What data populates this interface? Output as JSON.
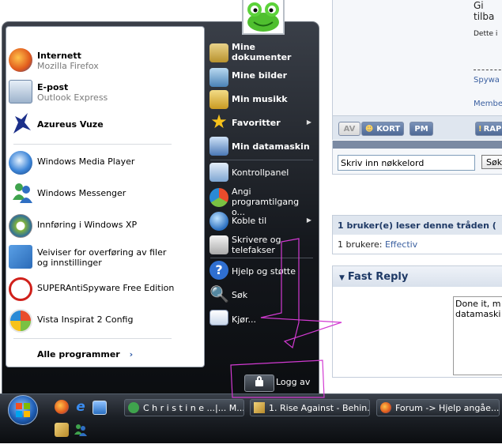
{
  "forum": {
    "top_text": "Gi tilba",
    "desc_text": "Dette i",
    "link1": "Spywa",
    "link2": "Membe",
    "btn_av": "AV",
    "btn_kort": "KORT",
    "btn_pm": "PM",
    "btn_rap": "RAP",
    "search_placeholder": "Skriv inn nøkkelord",
    "search_button": "Søk",
    "readers_title": "1 bruker(e) leser denne tråden (",
    "readers_prefix": "1 brukere: ",
    "readers_user": "Effectiv",
    "fast_reply_title": "Fast Reply",
    "reply_text_1": "Done it, m",
    "reply_text_2": "datamaski"
  },
  "start_menu": {
    "pinned": [
      {
        "title": "Internett",
        "subtitle": "Mozilla Firefox"
      },
      {
        "title": "E-post",
        "subtitle": "Outlook Express"
      },
      {
        "title": "Azureus Vuze"
      }
    ],
    "recent": [
      {
        "title": "Windows Media Player"
      },
      {
        "title": "Windows Messenger"
      },
      {
        "title": "Innføring i Windows XP"
      },
      {
        "title": "Veiviser for overføring av filer og innstillinger"
      },
      {
        "title": "SUPERAntiSpyware Free Edition"
      },
      {
        "title": "Vista Inspirat 2 Config"
      }
    ],
    "all_programs": "Alle programmer",
    "right": [
      {
        "label": "Mine dokumenter"
      },
      {
        "label": "Mine bilder"
      },
      {
        "label": "Min musikk"
      },
      {
        "label": "Favoritter"
      },
      {
        "label": "Min datamaskin"
      },
      {
        "label": "Kontrollpanel"
      },
      {
        "label": "Angi programtilgang o..."
      },
      {
        "label": "Koble til"
      },
      {
        "label": "Skrivere og telefakser"
      },
      {
        "label": "Hjelp og støtte"
      },
      {
        "label": "Søk"
      },
      {
        "label": "Kjør..."
      }
    ],
    "logoff": "Logg av"
  },
  "taskbar": {
    "tasks": [
      {
        "label": "C h r i s t i n e  ...|... M..."
      },
      {
        "label": "1. Rise Against - Behin..."
      },
      {
        "label": "Forum -> Hjelp angåe..."
      }
    ]
  },
  "colors": {
    "forum_header": "#3a5fa0",
    "annotation": "#d23ad2"
  }
}
